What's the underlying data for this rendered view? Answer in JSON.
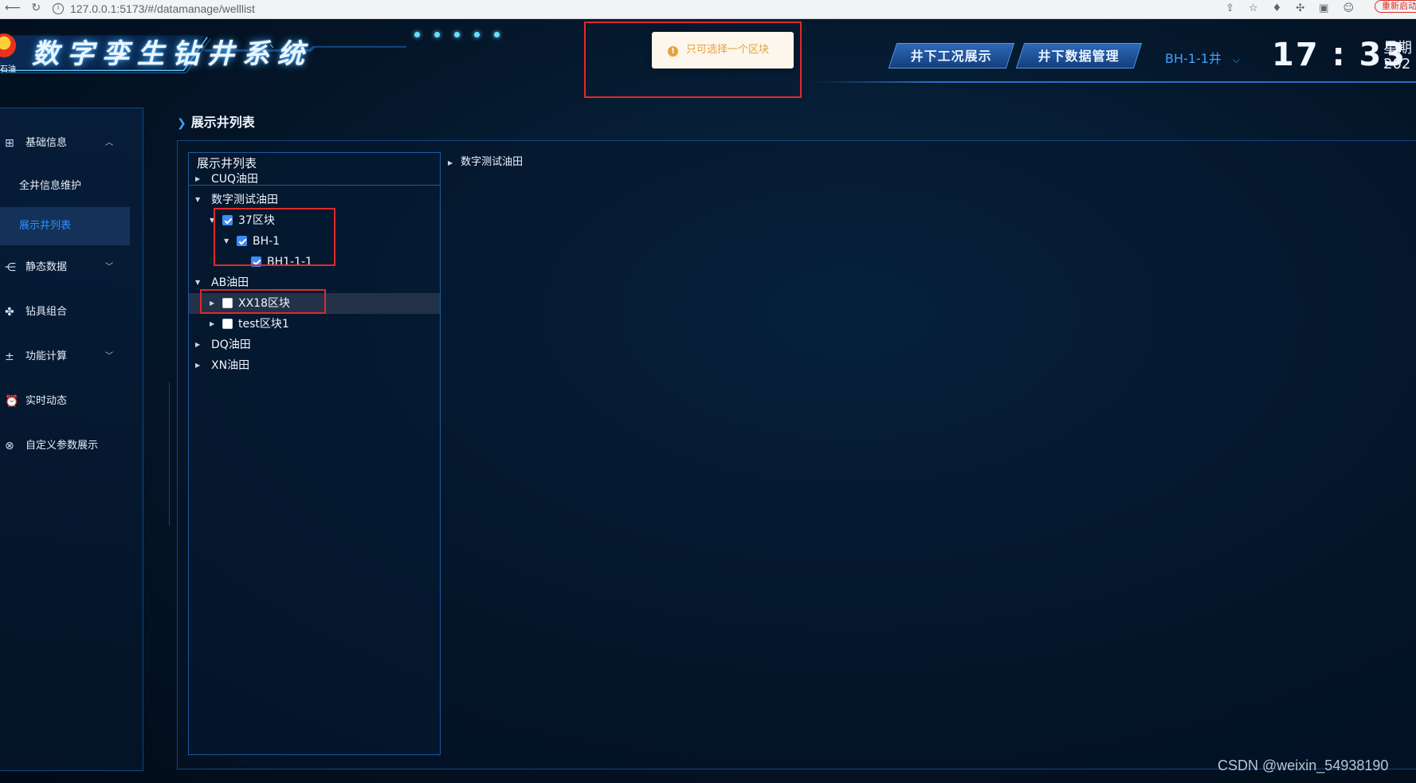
{
  "browser": {
    "url": "127.0.0.1:5173/#/datamanage/welllist",
    "update_label": "重新启动"
  },
  "header": {
    "logo_text": "石油",
    "system_title": "数字孪生钻井系统",
    "nav_buttons": [
      "井下工况展示",
      "井下数据管理"
    ],
    "well_selector": "BH-1-1井",
    "time": "17 : 33",
    "weekday": "星期",
    "year": "202"
  },
  "toast": {
    "message": "只可选择一个区块",
    "type": "warning"
  },
  "sidebar": {
    "items": [
      {
        "label": "基础信息",
        "icon": "grid-icon",
        "expanded": true
      },
      {
        "label": "全井信息维护",
        "sub": true
      },
      {
        "label": "展示井列表",
        "sub": true,
        "active": true
      },
      {
        "label": "静态数据",
        "icon": "network-icon",
        "expanded": false
      },
      {
        "label": "钻具组合",
        "icon": "cluster-icon"
      },
      {
        "label": "功能计算",
        "icon": "calculator-icon",
        "expanded": false
      },
      {
        "label": "实时动态",
        "icon": "alarm-icon"
      },
      {
        "label": "自定义参数展示",
        "icon": "settings-x-icon"
      }
    ]
  },
  "page": {
    "title": "展示井列表"
  },
  "tree": {
    "header": "展示井列表",
    "rows": [
      {
        "label": "CUQ油田",
        "level": 0,
        "caret": "right",
        "checkbox": false
      },
      {
        "label": "数字测试油田",
        "level": 0,
        "caret": "down",
        "checkbox": false
      },
      {
        "label": "37区块",
        "level": 1,
        "caret": "down",
        "checkbox": true,
        "checked": true
      },
      {
        "label": "BH-1",
        "level": 2,
        "caret": "down",
        "checkbox": true,
        "checked": true
      },
      {
        "label": "BH1-1-1",
        "level": 3,
        "caret": "none",
        "checkbox": true,
        "checked": true
      },
      {
        "label": "AB油田",
        "level": 0,
        "caret": "down",
        "checkbox": false
      },
      {
        "label": "XX18区块",
        "level": 1,
        "caret": "right",
        "checkbox": true,
        "checked": false,
        "hover": true
      },
      {
        "label": "test区块1",
        "level": 1,
        "caret": "right",
        "checkbox": true,
        "checked": false
      },
      {
        "label": "DQ油田",
        "level": 0,
        "caret": "right",
        "checkbox": false
      },
      {
        "label": "XN油田",
        "level": 0,
        "caret": "right",
        "checkbox": false
      }
    ]
  },
  "selected_tree": {
    "rows": [
      {
        "label": "数字测试油田"
      }
    ]
  },
  "watermark": "CSDN @weixin_54938190",
  "colors": {
    "accent": "#3e8cf5",
    "active_text": "#2f8cff",
    "warning": "#e6a23c",
    "annotation": "#e02a2a"
  }
}
